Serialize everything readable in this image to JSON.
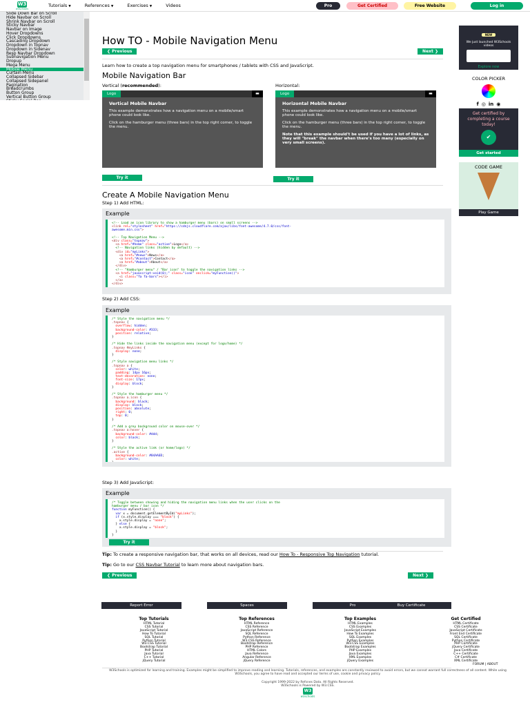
{
  "topnav": {
    "logo_text": "w3schools",
    "logo_mark": "W3",
    "links": [
      {
        "label": "Tutorials",
        "dropdown": true
      },
      {
        "label": "References",
        "dropdown": true
      },
      {
        "label": "Exercises",
        "dropdown": true
      },
      {
        "label": "Videos",
        "dropdown": false
      }
    ],
    "pro_label": "Pro",
    "certified_label": "Get Certified",
    "free_website_label": "Free Website",
    "login_label": "Log in"
  },
  "sidebar": {
    "items": [
      "Slide Down Bar on Scroll",
      "Hide Navbar on Scroll",
      "Shrink Navbar on Scroll",
      "Sticky Navbar",
      "Navbar on Image",
      "Hover Dropdowns",
      "Click Dropdowns",
      "Cascading Dropdown",
      "Dropdown in Topnav",
      "Dropdown in Sidenav",
      "Resp Navbar Dropdown",
      "Subnavigation Menu",
      "Dropup",
      "Mega Menu",
      "Mobile Menu",
      "Curtain Menu",
      "Collapsed Sidebar",
      "Collapsed Sidepanel",
      "Pagination",
      "Breadcrumbs",
      "Button Group",
      "Vertical Button Group",
      "Sticky Social Bar"
    ],
    "active_index": 14
  },
  "main": {
    "title": "How TO - Mobile Navigation Menu",
    "prev_label": "❮ Previous",
    "next_label": "Next ❯",
    "intro": "Learn how to create a top navigation menu for smartphones / tablets with CSS and JavaScript.",
    "section1_title": "Mobile Navigation Bar",
    "vertical_label_pre": "Vertical (",
    "vertical_label_bold": "recommended",
    "vertical_label_post": "):",
    "horizontal_label": "Horizontal:",
    "demo_logo": "Logo",
    "demo_vertical_title": "Vertical Mobile Navbar",
    "demo_vertical_p1": "This example demonstrates how a navigation menu on a mobile/smart phone could look like.",
    "demo_vertical_p2": "Click on the hamburger menu (three bars) in the top right corner, to toggle the menu.",
    "demo_horizontal_title": "Horizontal Mobile Navbar",
    "demo_horizontal_p1": "This example demonstrates how a navigation menu on a mobile/smart phone could look like.",
    "demo_horizontal_p2": "Click on the hamburger menu (three bars) in the top right corner, to toggle the menu.",
    "demo_horizontal_note": "Note that this example should't be used if you have a lot of links, as they will \"break\" the navbar when there's too many (especially on very small screens).",
    "try_label": "Try it Yourself »",
    "section2_title": "Create A Mobile Navigation Menu",
    "step1": "Step 1) Add HTML:",
    "step2": "Step 2) Add CSS:",
    "step3": "Step 3) Add JavaScript:",
    "example_label": "Example",
    "tip1_bold": "Tip:",
    "tip1_text": " To create a responsive navigation bar, that works on all devices, read our ",
    "tip1_link": "How To - Responsive Top Navigation",
    "tip1_end": " tutorial.",
    "tip2_bold": "Tip:",
    "tip2_text": " Go to our ",
    "tip2_link": "CSS Navbar Tutorial",
    "tip2_end": " to learn more about navigation bars."
  },
  "code_html": [
    [
      {
        "c": "c-com",
        "t": "<!-- Load an icon library to show a hamburger menu (bars) on small screens -->"
      }
    ],
    [
      {
        "c": "c-tag",
        "t": "<link "
      },
      {
        "c": "c-att",
        "t": "rel="
      },
      {
        "c": "c-val",
        "t": "\"stylesheet\""
      },
      {
        "c": "c-att",
        "t": " href="
      },
      {
        "c": "c-val",
        "t": "\"https://cdnjs.cloudflare.com/ajax/libs/font-awesome/4.7.0/css/font-"
      }
    ],
    [
      {
        "c": "c-val",
        "t": "awesome.min.css\""
      },
      {
        "c": "c-tag",
        "t": ">"
      }
    ],
    [
      {
        "c": "",
        "t": " "
      }
    ],
    [
      {
        "c": "c-com",
        "t": "<!-- Top Navigation Menu -->"
      }
    ],
    [
      {
        "c": "c-tag",
        "t": "<div "
      },
      {
        "c": "c-att",
        "t": "class="
      },
      {
        "c": "c-val",
        "t": "\"topnav\""
      },
      {
        "c": "c-tag",
        "t": ">"
      }
    ],
    [
      {
        "c": "c-tag",
        "t": "  <a "
      },
      {
        "c": "c-att",
        "t": "href="
      },
      {
        "c": "c-val",
        "t": "\"#home\""
      },
      {
        "c": "c-att",
        "t": " class="
      },
      {
        "c": "c-val",
        "t": "\"active\""
      },
      {
        "c": "c-tag",
        "t": ">"
      },
      {
        "c": "",
        "t": "Logo"
      },
      {
        "c": "c-tag",
        "t": "</a>"
      }
    ],
    [
      {
        "c": "c-com",
        "t": "  <!-- Navigation links (hidden by default) -->"
      }
    ],
    [
      {
        "c": "c-tag",
        "t": "  <div "
      },
      {
        "c": "c-att",
        "t": "id="
      },
      {
        "c": "c-val",
        "t": "\"myLinks\""
      },
      {
        "c": "c-tag",
        "t": ">"
      }
    ],
    [
      {
        "c": "c-tag",
        "t": "    <a "
      },
      {
        "c": "c-att",
        "t": "href="
      },
      {
        "c": "c-val",
        "t": "\"#news\""
      },
      {
        "c": "c-tag",
        "t": ">"
      },
      {
        "c": "",
        "t": "News"
      },
      {
        "c": "c-tag",
        "t": "</a>"
      }
    ],
    [
      {
        "c": "c-tag",
        "t": "    <a "
      },
      {
        "c": "c-att",
        "t": "href="
      },
      {
        "c": "c-val",
        "t": "\"#contact\""
      },
      {
        "c": "c-tag",
        "t": ">"
      },
      {
        "c": "",
        "t": "Contact"
      },
      {
        "c": "c-tag",
        "t": "</a>"
      }
    ],
    [
      {
        "c": "c-tag",
        "t": "    <a "
      },
      {
        "c": "c-att",
        "t": "href="
      },
      {
        "c": "c-val",
        "t": "\"#about\""
      },
      {
        "c": "c-tag",
        "t": ">"
      },
      {
        "c": "",
        "t": "About"
      },
      {
        "c": "c-tag",
        "t": "</a>"
      }
    ],
    [
      {
        "c": "c-tag",
        "t": "  </div>"
      }
    ],
    [
      {
        "c": "c-com",
        "t": "  <!-- \"Hamburger menu\" / \"Bar icon\" to toggle the navigation links -->"
      }
    ],
    [
      {
        "c": "c-tag",
        "t": "  <a "
      },
      {
        "c": "c-att",
        "t": "href="
      },
      {
        "c": "c-val",
        "t": "\"javascript:void(0);\""
      },
      {
        "c": "c-att",
        "t": " class="
      },
      {
        "c": "c-val",
        "t": "\"icon\""
      },
      {
        "c": "c-att",
        "t": " onclick="
      },
      {
        "c": "c-val",
        "t": "\"myFunction()\""
      },
      {
        "c": "c-tag",
        "t": ">"
      }
    ],
    [
      {
        "c": "c-tag",
        "t": "    <i "
      },
      {
        "c": "c-att",
        "t": "class="
      },
      {
        "c": "c-val",
        "t": "\"fa fa-bars\""
      },
      {
        "c": "c-tag",
        "t": "></i>"
      }
    ],
    [
      {
        "c": "c-tag",
        "t": "  </a>"
      }
    ],
    [
      {
        "c": "c-tag",
        "t": "</div>"
      }
    ]
  ],
  "code_css": [
    [
      {
        "c": "c-com",
        "t": "/* Style the navigation menu */"
      }
    ],
    [
      {
        "c": "c-sel",
        "t": ".topnav "
      },
      {
        "c": "",
        "t": "{"
      }
    ],
    [
      {
        "c": "c-att",
        "t": "  overflow"
      },
      {
        "c": "",
        "t": ": "
      },
      {
        "c": "c-val",
        "t": "hidden"
      },
      {
        "c": "",
        "t": ";"
      }
    ],
    [
      {
        "c": "c-att",
        "t": "  background-color"
      },
      {
        "c": "",
        "t": ": "
      },
      {
        "c": "c-val",
        "t": "#333"
      },
      {
        "c": "",
        "t": ";"
      }
    ],
    [
      {
        "c": "c-att",
        "t": "  position"
      },
      {
        "c": "",
        "t": ": "
      },
      {
        "c": "c-val",
        "t": "relative"
      },
      {
        "c": "",
        "t": ";"
      }
    ],
    [
      {
        "c": "",
        "t": "}"
      }
    ],
    [
      {
        "c": "",
        "t": " "
      }
    ],
    [
      {
        "c": "c-com",
        "t": "/* Hide the links inside the navigation menu (except for logo/home) */"
      }
    ],
    [
      {
        "c": "c-sel",
        "t": ".topnav #myLinks "
      },
      {
        "c": "",
        "t": "{"
      }
    ],
    [
      {
        "c": "c-att",
        "t": "  display"
      },
      {
        "c": "",
        "t": ": "
      },
      {
        "c": "c-val",
        "t": "none"
      },
      {
        "c": "",
        "t": ";"
      }
    ],
    [
      {
        "c": "",
        "t": "}"
      }
    ],
    [
      {
        "c": "",
        "t": " "
      }
    ],
    [
      {
        "c": "c-com",
        "t": "/* Style navigation menu links */"
      }
    ],
    [
      {
        "c": "c-sel",
        "t": ".topnav a "
      },
      {
        "c": "",
        "t": "{"
      }
    ],
    [
      {
        "c": "c-att",
        "t": "  color"
      },
      {
        "c": "",
        "t": ": "
      },
      {
        "c": "c-val",
        "t": "white"
      },
      {
        "c": "",
        "t": ";"
      }
    ],
    [
      {
        "c": "c-att",
        "t": "  padding"
      },
      {
        "c": "",
        "t": ": "
      },
      {
        "c": "c-val",
        "t": "14px 16px"
      },
      {
        "c": "",
        "t": ";"
      }
    ],
    [
      {
        "c": "c-att",
        "t": "  text-decoration"
      },
      {
        "c": "",
        "t": ": "
      },
      {
        "c": "c-val",
        "t": "none"
      },
      {
        "c": "",
        "t": ";"
      }
    ],
    [
      {
        "c": "c-att",
        "t": "  font-size"
      },
      {
        "c": "",
        "t": ": "
      },
      {
        "c": "c-val",
        "t": "17px"
      },
      {
        "c": "",
        "t": ";"
      }
    ],
    [
      {
        "c": "c-att",
        "t": "  display"
      },
      {
        "c": "",
        "t": ": "
      },
      {
        "c": "c-val",
        "t": "block"
      },
      {
        "c": "",
        "t": ";"
      }
    ],
    [
      {
        "c": "",
        "t": "}"
      }
    ],
    [
      {
        "c": "",
        "t": " "
      }
    ],
    [
      {
        "c": "c-com",
        "t": "/* Style the hamburger menu */"
      }
    ],
    [
      {
        "c": "c-sel",
        "t": ".topnav a.icon "
      },
      {
        "c": "",
        "t": "{"
      }
    ],
    [
      {
        "c": "c-att",
        "t": "  background"
      },
      {
        "c": "",
        "t": ": "
      },
      {
        "c": "c-val",
        "t": "black"
      },
      {
        "c": "",
        "t": ";"
      }
    ],
    [
      {
        "c": "c-att",
        "t": "  display"
      },
      {
        "c": "",
        "t": ": "
      },
      {
        "c": "c-val",
        "t": "block"
      },
      {
        "c": "",
        "t": ";"
      }
    ],
    [
      {
        "c": "c-att",
        "t": "  position"
      },
      {
        "c": "",
        "t": ": "
      },
      {
        "c": "c-val",
        "t": "absolute"
      },
      {
        "c": "",
        "t": ";"
      }
    ],
    [
      {
        "c": "c-att",
        "t": "  right"
      },
      {
        "c": "",
        "t": ": "
      },
      {
        "c": "c-val",
        "t": "0"
      },
      {
        "c": "",
        "t": ";"
      }
    ],
    [
      {
        "c": "c-att",
        "t": "  top"
      },
      {
        "c": "",
        "t": ": "
      },
      {
        "c": "c-val",
        "t": "0"
      },
      {
        "c": "",
        "t": ";"
      }
    ],
    [
      {
        "c": "",
        "t": "}"
      }
    ],
    [
      {
        "c": "",
        "t": " "
      }
    ],
    [
      {
        "c": "c-com",
        "t": "/* Add a grey background color on mouse-over */"
      }
    ],
    [
      {
        "c": "c-sel",
        "t": ".topnav a:hover "
      },
      {
        "c": "",
        "t": "{"
      }
    ],
    [
      {
        "c": "c-att",
        "t": "  background-color"
      },
      {
        "c": "",
        "t": ": "
      },
      {
        "c": "c-val",
        "t": "#ddd"
      },
      {
        "c": "",
        "t": ";"
      }
    ],
    [
      {
        "c": "c-att",
        "t": "  color"
      },
      {
        "c": "",
        "t": ": "
      },
      {
        "c": "c-val",
        "t": "black"
      },
      {
        "c": "",
        "t": ";"
      }
    ],
    [
      {
        "c": "",
        "t": "}"
      }
    ],
    [
      {
        "c": "",
        "t": " "
      }
    ],
    [
      {
        "c": "c-com",
        "t": "/* Style the active link (or home/logo) */"
      }
    ],
    [
      {
        "c": "c-sel",
        "t": ".active "
      },
      {
        "c": "",
        "t": "{"
      }
    ],
    [
      {
        "c": "c-att",
        "t": "  background-color"
      },
      {
        "c": "",
        "t": ": "
      },
      {
        "c": "c-val",
        "t": "#04AA6D"
      },
      {
        "c": "",
        "t": ";"
      }
    ],
    [
      {
        "c": "c-att",
        "t": "  color"
      },
      {
        "c": "",
        "t": ": "
      },
      {
        "c": "c-val",
        "t": "white"
      },
      {
        "c": "",
        "t": ";"
      }
    ],
    [
      {
        "c": "",
        "t": "}"
      }
    ]
  ],
  "code_js": [
    [
      {
        "c": "c-com",
        "t": "/* Toggle between showing and hiding the navigation menu links when the user clicks on the"
      }
    ],
    [
      {
        "c": "c-com",
        "t": "hamburger menu / bar icon */"
      }
    ],
    [
      {
        "c": "c-kw",
        "t": "function"
      },
      {
        "c": "",
        "t": " myFunction() {"
      }
    ],
    [
      {
        "c": "c-kw",
        "t": "  var"
      },
      {
        "c": "",
        "t": " x = document.getElementById("
      },
      {
        "c": "c-att",
        "t": "\"myLinks\""
      },
      {
        "c": "",
        "t": ");"
      }
    ],
    [
      {
        "c": "c-kw",
        "t": "  if"
      },
      {
        "c": "",
        "t": " (x.style.display === "
      },
      {
        "c": "c-att",
        "t": "\"block\""
      },
      {
        "c": "",
        "t": ") {"
      }
    ],
    [
      {
        "c": "",
        "t": "    x.style.display = "
      },
      {
        "c": "c-att",
        "t": "\"none\""
      },
      {
        "c": "",
        "t": ";"
      }
    ],
    [
      {
        "c": "",
        "t": "  } "
      },
      {
        "c": "c-kw",
        "t": "else"
      },
      {
        "c": "",
        "t": " {"
      }
    ],
    [
      {
        "c": "",
        "t": "    x.style.display = "
      },
      {
        "c": "c-att",
        "t": "\"block\""
      },
      {
        "c": "",
        "t": ";"
      }
    ],
    [
      {
        "c": "",
        "t": "  }"
      }
    ],
    [
      {
        "c": "",
        "t": "}"
      }
    ]
  ],
  "rightcol": {
    "new_badge": "NEW",
    "launched_text": "We just launched W3Schools videos",
    "explore_label": "Explore now",
    "color_picker_label": "COLOR PICKER",
    "get_certified_text": "Get certified by completing a course today!",
    "get_started_label": "Get started",
    "code_game_label": "CODE GAME",
    "play_game_label": "Play Game"
  },
  "footer": {
    "buttons": [
      "Report Error",
      "Spaces",
      "Pro",
      "Buy Certificate"
    ],
    "columns": [
      {
        "title": "Top Tutorials",
        "links": [
          "HTML Tutorial",
          "CSS Tutorial",
          "JavaScript Tutorial",
          "How To Tutorial",
          "SQL Tutorial",
          "Python Tutorial",
          "W3.CSS Tutorial",
          "Bootstrap Tutorial",
          "PHP Tutorial",
          "Java Tutorial",
          "C++ Tutorial",
          "jQuery Tutorial"
        ]
      },
      {
        "title": "Top References",
        "links": [
          "HTML Reference",
          "CSS Reference",
          "JavaScript Reference",
          "SQL Reference",
          "Python Reference",
          "W3.CSS Reference",
          "Bootstrap Reference",
          "PHP Reference",
          "HTML Colors",
          "Java Reference",
          "Angular Reference",
          "jQuery Reference"
        ]
      },
      {
        "title": "Top Examples",
        "links": [
          "HTML Examples",
          "CSS Examples",
          "JavaScript Examples",
          "How To Examples",
          "SQL Examples",
          "Python Examples",
          "W3.CSS Examples",
          "Bootstrap Examples",
          "PHP Examples",
          "Java Examples",
          "XML Examples",
          "jQuery Examples"
        ]
      },
      {
        "title": "Get Certified",
        "links": [
          "HTML Certificate",
          "CSS Certificate",
          "JavaScript Certificate",
          "Front End Certificate",
          "SQL Certificate",
          "Python Certificate",
          "PHP Certificate",
          "jQuery Certificate",
          "Java Certificate",
          "C++ Certificate",
          "C# Certificate",
          "XML Certificate"
        ]
      }
    ],
    "forum_about": "FORUM | ABOUT",
    "disclaimer": "W3Schools is optimized for learning and training. Examples might be simplified to improve reading and learning. Tutorials, references, and examples are constantly reviewed to avoid errors, but we cannot warrant full correctness of all content. While using W3Schools, you agree to have read and accepted our terms of use, cookie and privacy policy.",
    "copyright": "Copyright 1999-2022 by Refsnes Data. All Rights Reserved.",
    "powered": "W3Schools is Powered by W3.CSS.",
    "logo_text": "w3schools"
  },
  "colors": {
    "accent": "#04aa6d",
    "dark": "#282a35",
    "pro": "#282a35",
    "certified": "#ffc0c7",
    "free_website": "#fff4a3"
  }
}
